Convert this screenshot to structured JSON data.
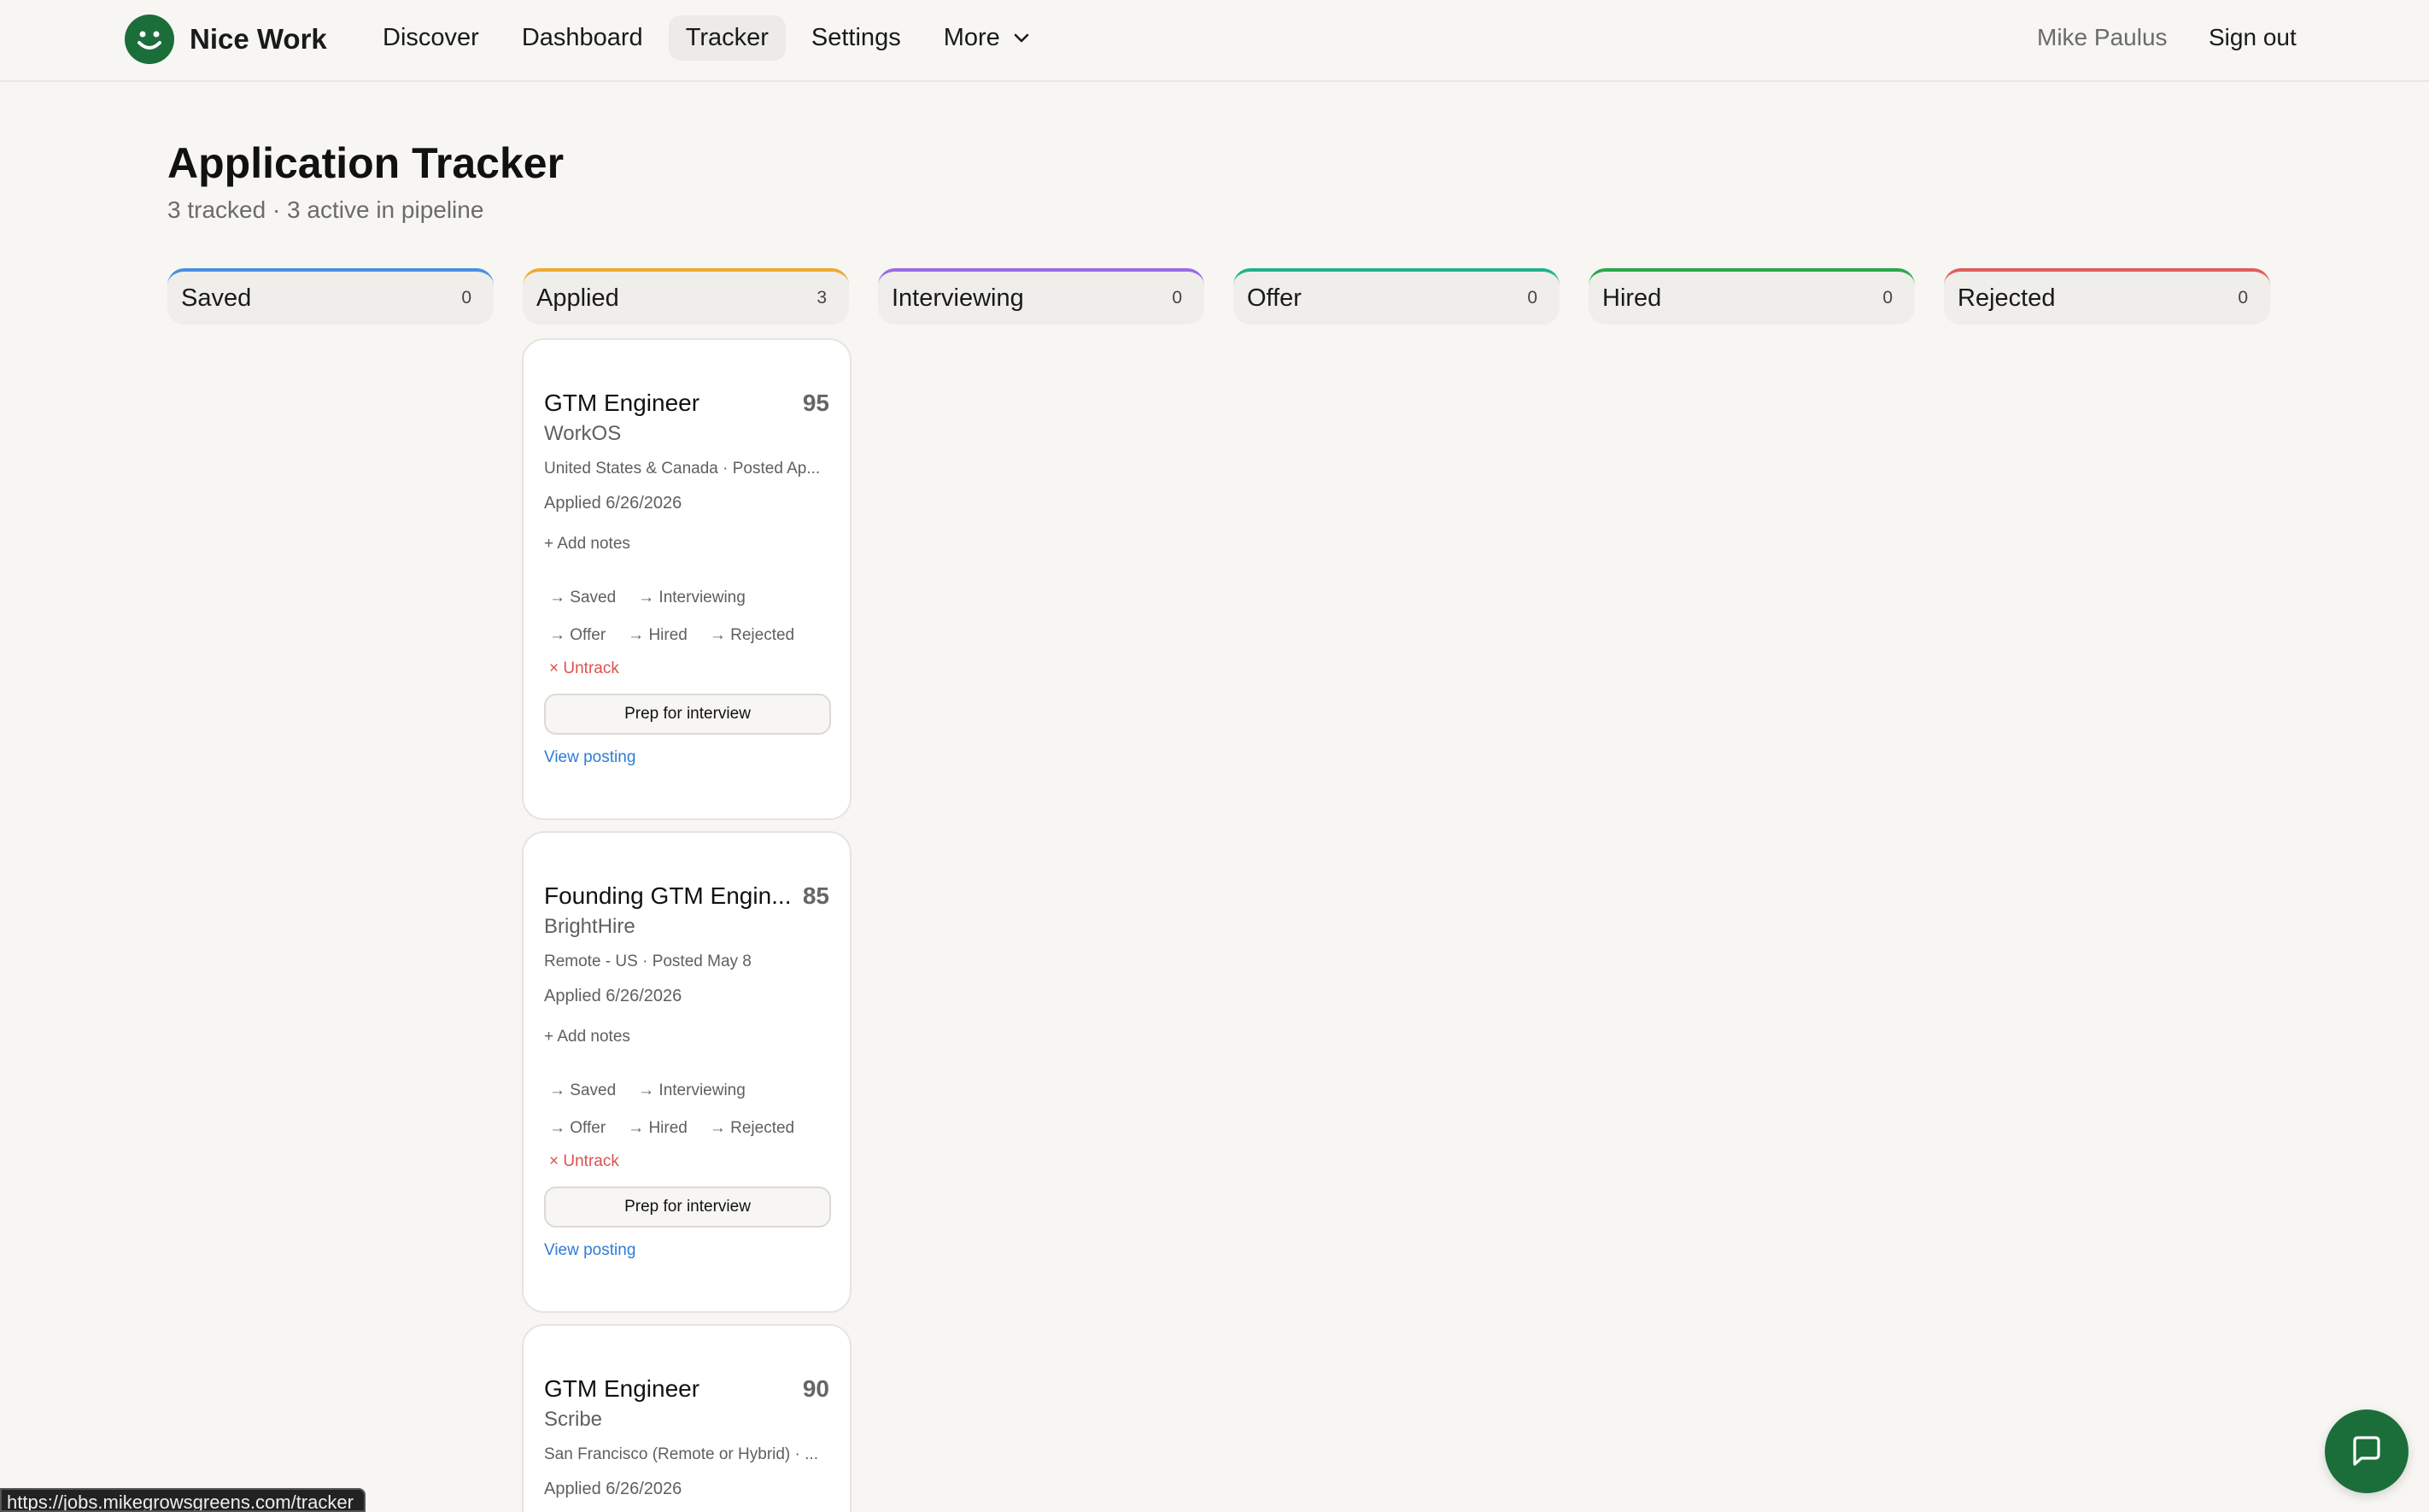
{
  "app": {
    "name": "Nice Work",
    "brand_color": "#1b6e3a"
  },
  "nav": {
    "items": [
      {
        "label": "Discover"
      },
      {
        "label": "Dashboard"
      },
      {
        "label": "Tracker",
        "active": true
      },
      {
        "label": "Settings"
      },
      {
        "label": "More"
      }
    ]
  },
  "user": {
    "name": "Mike Paulus",
    "signout_label": "Sign out"
  },
  "page": {
    "title": "Application Tracker",
    "subtitle": "3 tracked · 3 active in pipeline"
  },
  "columns": [
    {
      "title": "Saved",
      "count": "0",
      "color": "#4a8fe0"
    },
    {
      "title": "Applied",
      "count": "3",
      "color": "#f0a92e"
    },
    {
      "title": "Interviewing",
      "count": "0",
      "color": "#9a6be8"
    },
    {
      "title": "Offer",
      "count": "0",
      "color": "#20b28c"
    },
    {
      "title": "Hired",
      "count": "0",
      "color": "#2aa84a"
    },
    {
      "title": "Rejected",
      "count": "0",
      "color": "#e05d5d"
    }
  ],
  "cards": [
    {
      "title": "GTM Engineer",
      "score": "95",
      "company": "WorkOS",
      "meta": "United States & Canada · Posted Ap...",
      "applied": "Applied 6/26/2026",
      "notes_label": "+ Add notes",
      "moves": [
        "→ Saved",
        "→ Interviewing",
        "→ Offer",
        "→ Hired",
        "→ Rejected"
      ],
      "untrack_label": "× Untrack",
      "prep_label": "Prep for interview",
      "view_label": "View posting"
    },
    {
      "title": "Founding GTM Engin...",
      "score": "85",
      "company": "BrightHire",
      "meta": "Remote - US · Posted May 8",
      "applied": "Applied 6/26/2026",
      "notes_label": "+ Add notes",
      "moves": [
        "→ Saved",
        "→ Interviewing",
        "→ Offer",
        "→ Hired",
        "→ Rejected"
      ],
      "untrack_label": "× Untrack",
      "prep_label": "Prep for interview",
      "view_label": "View posting"
    },
    {
      "title": "GTM Engineer",
      "score": "90",
      "company": "Scribe",
      "meta": "San Francisco (Remote or Hybrid) · ...",
      "applied": "Applied 6/26/2026"
    }
  ],
  "status_url": "https://jobs.mikegrowsgreens.com/tracker"
}
